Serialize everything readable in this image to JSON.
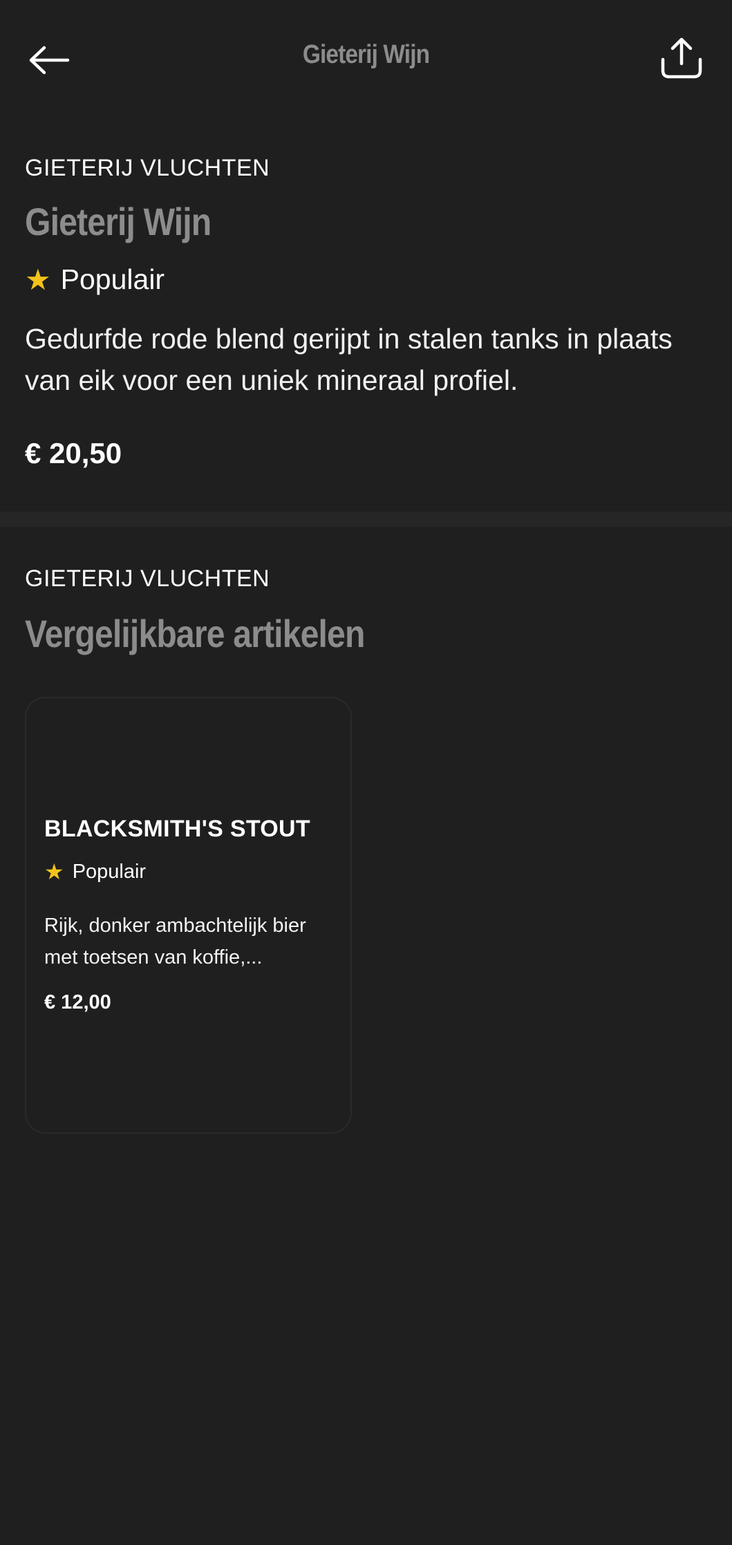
{
  "header": {
    "title": "Gieterij Wijn",
    "back_icon": "arrow-left-icon",
    "share_icon": "share-icon"
  },
  "product": {
    "category": "GIETERIJ VLUCHTEN",
    "title": "Gieterij Wijn",
    "badge_icon": "star-icon",
    "badge_label": "Populair",
    "description": "Gedurfde rode blend gerijpt in stalen tanks in plaats van eik voor een uniek mineraal profiel.",
    "price": "€ 20,50"
  },
  "similar": {
    "category": "GIETERIJ VLUCHTEN",
    "title": "Vergelijkbare artikelen",
    "items": [
      {
        "name": "BLACKSMITH'S STOUT",
        "badge_label": "Populair",
        "description": "Rijk, donker ambachtelijk bier met toetsen van koffie,...",
        "price": "€ 12,00"
      }
    ]
  },
  "colors": {
    "background": "#1f1f1f",
    "divider": "#262626",
    "muted_title": "#8c8c8c",
    "star": "#f5c21b",
    "text": "#ffffff"
  }
}
